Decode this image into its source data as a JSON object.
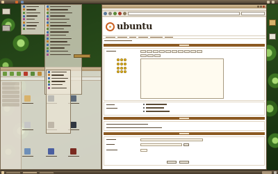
{
  "top_panel": {
    "menus": [
      "",
      "",
      ""
    ],
    "clock": ""
  },
  "desktop": {
    "icons_left": [
      {
        "name": "computer-icon",
        "label": ""
      },
      {
        "name": "trash-icon",
        "label": ""
      }
    ],
    "icons_right": [
      {
        "name": "folder-icon",
        "label": ""
      },
      {
        "name": "document-icon",
        "label": ""
      }
    ]
  },
  "firefox": {
    "title": "",
    "menubar": [
      "",
      "",
      "",
      "",
      "",
      "",
      ""
    ],
    "url": "",
    "page": {
      "logo_text": "ubuntu",
      "logo_sub": "",
      "nav_links": [
        "",
        "",
        "",
        "",
        "",
        ""
      ],
      "section_post": "",
      "section_options": "",
      "section_poll": ""
    }
  },
  "file_manager": {
    "title": "",
    "sidebar_items": [
      "",
      "",
      "",
      "",
      "",
      ""
    ],
    "files": [
      "",
      "",
      "",
      "",
      "",
      "",
      "",
      "",
      ""
    ]
  },
  "colors": {
    "panel_brown": "#6d5e48",
    "ubuntu_orange": "#c95f22",
    "section_brown": "#8c5a22",
    "menu_highlight": "#b0893f"
  },
  "taskbar": {
    "items": [
      "",
      "",
      ""
    ]
  }
}
